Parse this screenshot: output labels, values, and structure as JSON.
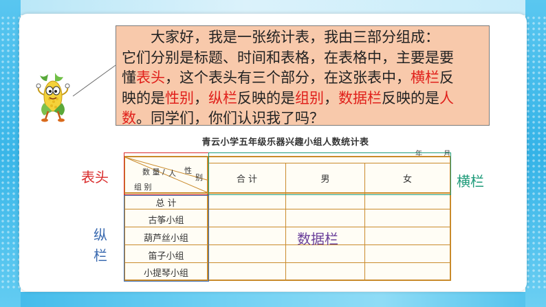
{
  "speech": {
    "lines": [
      [
        {
          "t": "　　大家好，我是一张统计表，我由三部分组成：",
          "c": ""
        }
      ],
      [
        {
          "t": "它们分别是标题、时间和表格，在表格中，主要是要",
          "c": ""
        }
      ],
      [
        {
          "t": "懂",
          "c": ""
        },
        {
          "t": "表头",
          "c": "red"
        },
        {
          "t": "，这个表头有三个部分，在这张表中，",
          "c": ""
        },
        {
          "t": "横栏",
          "c": "red"
        },
        {
          "t": "反",
          "c": ""
        }
      ],
      [
        {
          "t": "映的是",
          "c": ""
        },
        {
          "t": "性别",
          "c": "red"
        },
        {
          "t": "，",
          "c": ""
        },
        {
          "t": "纵栏",
          "c": "red"
        },
        {
          "t": "反映的是",
          "c": ""
        },
        {
          "t": "组别",
          "c": "red"
        },
        {
          "t": "，",
          "c": ""
        },
        {
          "t": "数据栏",
          "c": "red"
        },
        {
          "t": "反映的是",
          "c": ""
        },
        {
          "t": "人",
          "c": "red"
        }
      ],
      [
        {
          "t": "数",
          "c": "red"
        },
        {
          "t": "。同学们，你们认识我了吗？",
          "c": ""
        }
      ]
    ]
  },
  "table": {
    "title": "青云小学五年级乐器兴趣小组人数统计表",
    "date": "年 月",
    "corner": {
      "top_left": "数 量",
      "sep": "/",
      "top_right": "人",
      "gender_a": "性",
      "gender_b": "别",
      "bottom_left": "组 别"
    },
    "columns": [
      "合 计",
      "男",
      "女"
    ],
    "rows": [
      "总 计",
      "古筝小组",
      "葫芦丝小组",
      "笛子小组",
      "小提琴小组"
    ]
  },
  "labels": {
    "header": "表头",
    "horizontal": "横栏",
    "vertical_a": "纵",
    "vertical_b": "栏",
    "data": "数据栏"
  },
  "colors": {
    "header": "#d92b2b",
    "horizontal": "#1e9b7a",
    "vertical": "#3a6ab0",
    "data": "#6a3f9a",
    "speech_bg": "#f8c9ab",
    "highlight_red": "#e0201b",
    "table_line": "#c98a2a"
  },
  "mascot": {
    "icon": "corn-mascot-icon"
  }
}
